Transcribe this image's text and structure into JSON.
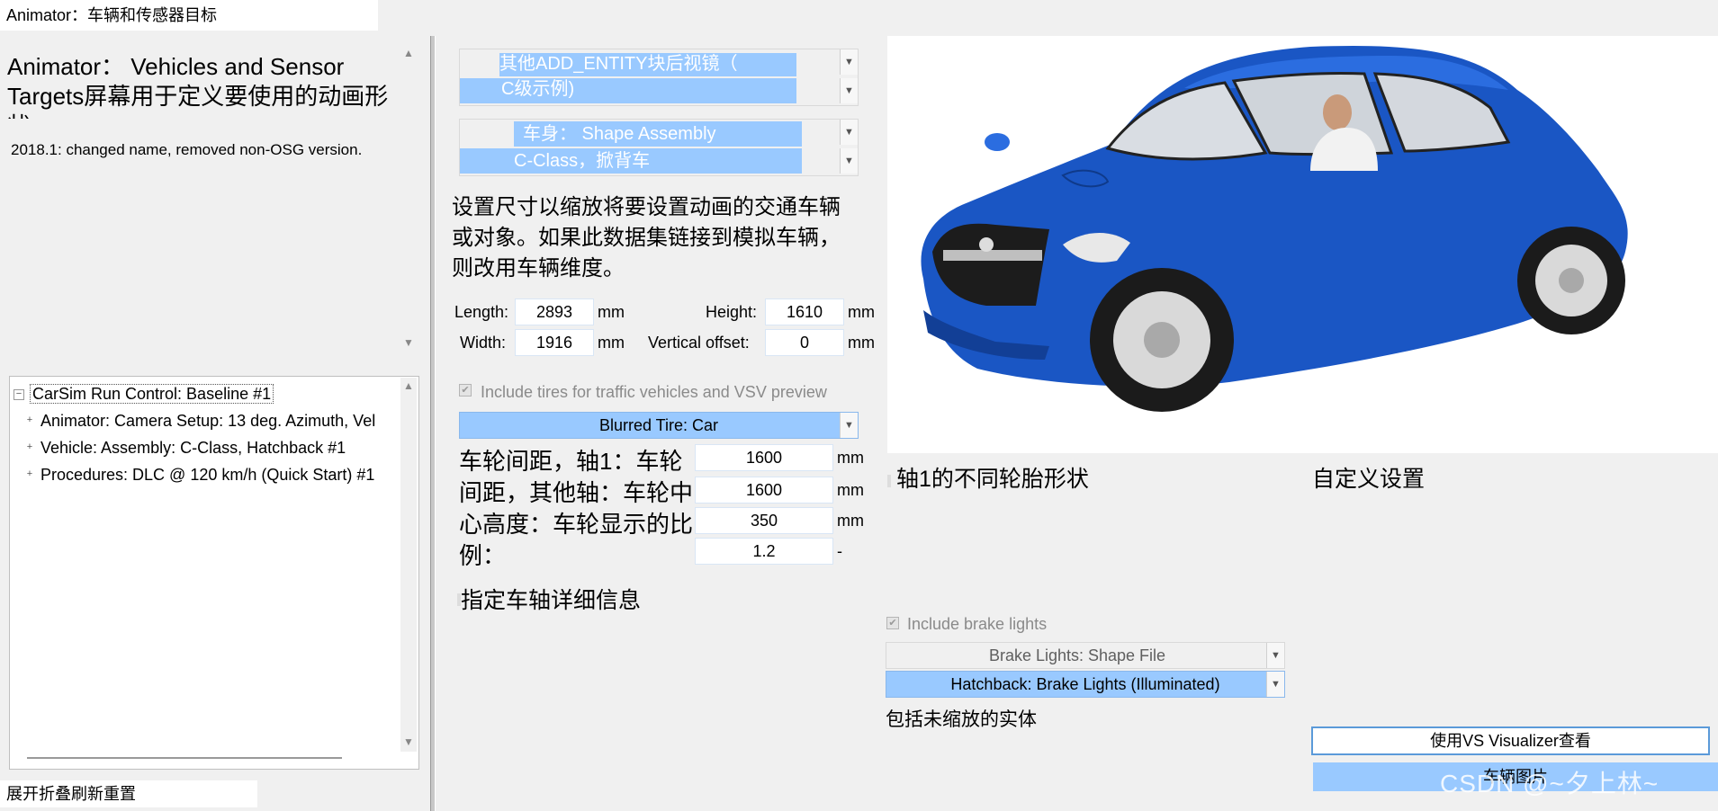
{
  "window": {
    "title": "Animator：车辆和传感器目标"
  },
  "left": {
    "heading": "Animator： Vehicles and Sensor Targets屏幕用于定义要使用的动画形状",
    "notes": "2018.1: changed name, removed non-OSG version.",
    "tree": {
      "root": "CarSim Run Control: Baseline #1",
      "children": [
        "Animator: Camera Setup: 13 deg. Azimuth, Vel",
        "Vehicle: Assembly: C-Class, Hatchback #1",
        "Procedures: DLC @ 120 km/h (Quick Start) #1"
      ]
    },
    "bottom_buttons": "展开折叠刷新重置"
  },
  "middle": {
    "dropdown1": {
      "line1": "其他ADD_ENTITY块后视镜（",
      "line2": "C级示例)"
    },
    "dropdown2": {
      "line1": "车身： Shape Assembly",
      "line2": "C-Class，掀背车"
    },
    "description": "设置尺寸以缩放将要设置动画的交通车辆或对象。如果此数据集链接到模拟车辆，则改用车辆维度。",
    "dims": {
      "length_label": "Length:",
      "length_value": "2893",
      "length_unit": "mm",
      "height_label": "Height:",
      "height_value": "1610",
      "height_unit": "mm",
      "width_label": "Width:",
      "width_value": "1916",
      "width_unit": "mm",
      "voffset_label": "Vertical offset:",
      "voffset_value": "0",
      "voffset_unit": "mm"
    },
    "include_tires_label": "Include tires for traffic vehicles and VSV preview",
    "tire_dropdown": "Blurred Tire: Car",
    "wheel_desc": "车轮间距，轴1：车轮间距，其他轴：车轮中心高度：车轮显示的比例：",
    "wheel_fields": [
      {
        "value": "1600",
        "unit": "mm"
      },
      {
        "value": "1600",
        "unit": "mm"
      },
      {
        "value": "350",
        "unit": "mm"
      },
      {
        "value": "1.2",
        "unit": "-"
      }
    ],
    "axle_details_label": "指定车轴详细信息"
  },
  "right": {
    "axle1_tire_label": "轴1的不同轮胎形状",
    "custom_settings_label": "自定义设置",
    "include_brake_lights_label": "Include brake lights",
    "brake_shape_file": "Brake Lights: Shape File",
    "brake_lights_dropdown": "Hatchback: Brake Lights (Illuminated)",
    "unscaled_label": "包括未缩放的实体",
    "vs_button": "使用VS Visualizer查看",
    "vehicle_image_dropdown": "车辆图片",
    "watermark": "CSDN @~夕上林~"
  },
  "colors": {
    "selection_blue": "#99c9ff",
    "car_blue": "#1a56c4"
  }
}
